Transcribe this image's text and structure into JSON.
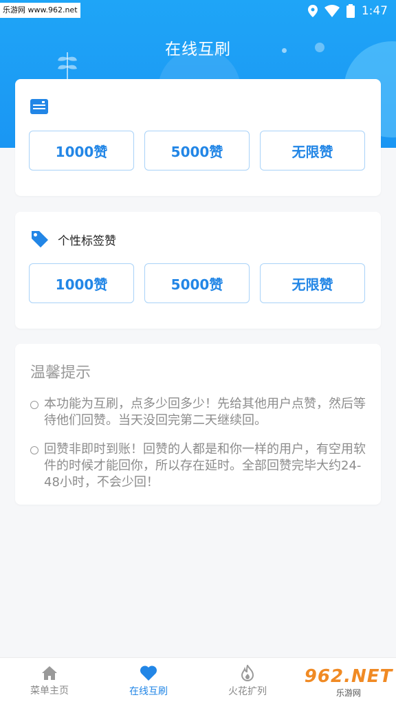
{
  "status_bar": {
    "time": "1:47"
  },
  "watermark_top": "乐游网 www.962.net",
  "header": {
    "title": "在线互刷"
  },
  "section1": {
    "label": "",
    "buttons": [
      "1000赞",
      "5000赞",
      "无限赞"
    ]
  },
  "section2": {
    "label": "个性标签赞",
    "buttons": [
      "1000赞",
      "5000赞",
      "无限赞"
    ]
  },
  "tips": {
    "title": "温馨提示",
    "items": [
      "本功能为互刷，点多少回多少！先给其他用户点赞，然后等待他们回赞。当天没回完第二天继续回。",
      "回赞非即时到账！回赞的人都是和你一样的用户，有空用软件的时候才能回你，所以存在延时。全部回赞完毕大约24-48小时，不会少回！"
    ]
  },
  "tabbar": {
    "tabs": [
      {
        "label": "菜单主页",
        "icon": "home-icon"
      },
      {
        "label": "在线互刷",
        "icon": "heart-icon",
        "active": true
      },
      {
        "label": "火花扩列",
        "icon": "flame-icon"
      }
    ]
  },
  "watermark_bottom": {
    "big": "962.NET",
    "small": "乐游网"
  },
  "colors": {
    "accent": "#2286e6",
    "header_bg": "#1a96f3",
    "button_border": "#a8d2f8"
  }
}
